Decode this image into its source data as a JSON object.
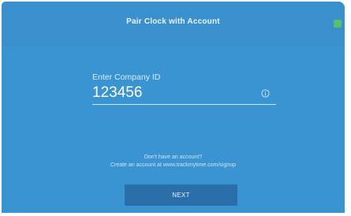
{
  "header": {
    "title": "Pair Clock with Account",
    "status_color": "#58c06a"
  },
  "form": {
    "label": "Enter Company ID",
    "value": "123456",
    "info_icon": "info-icon"
  },
  "signup": {
    "line1": "Don't have an account?",
    "line2": "Create an account at www.trackmytime.com/signup"
  },
  "actions": {
    "next_label": "NEXT"
  },
  "colors": {
    "background": "#3a94d2",
    "button": "#2a6fa9"
  }
}
